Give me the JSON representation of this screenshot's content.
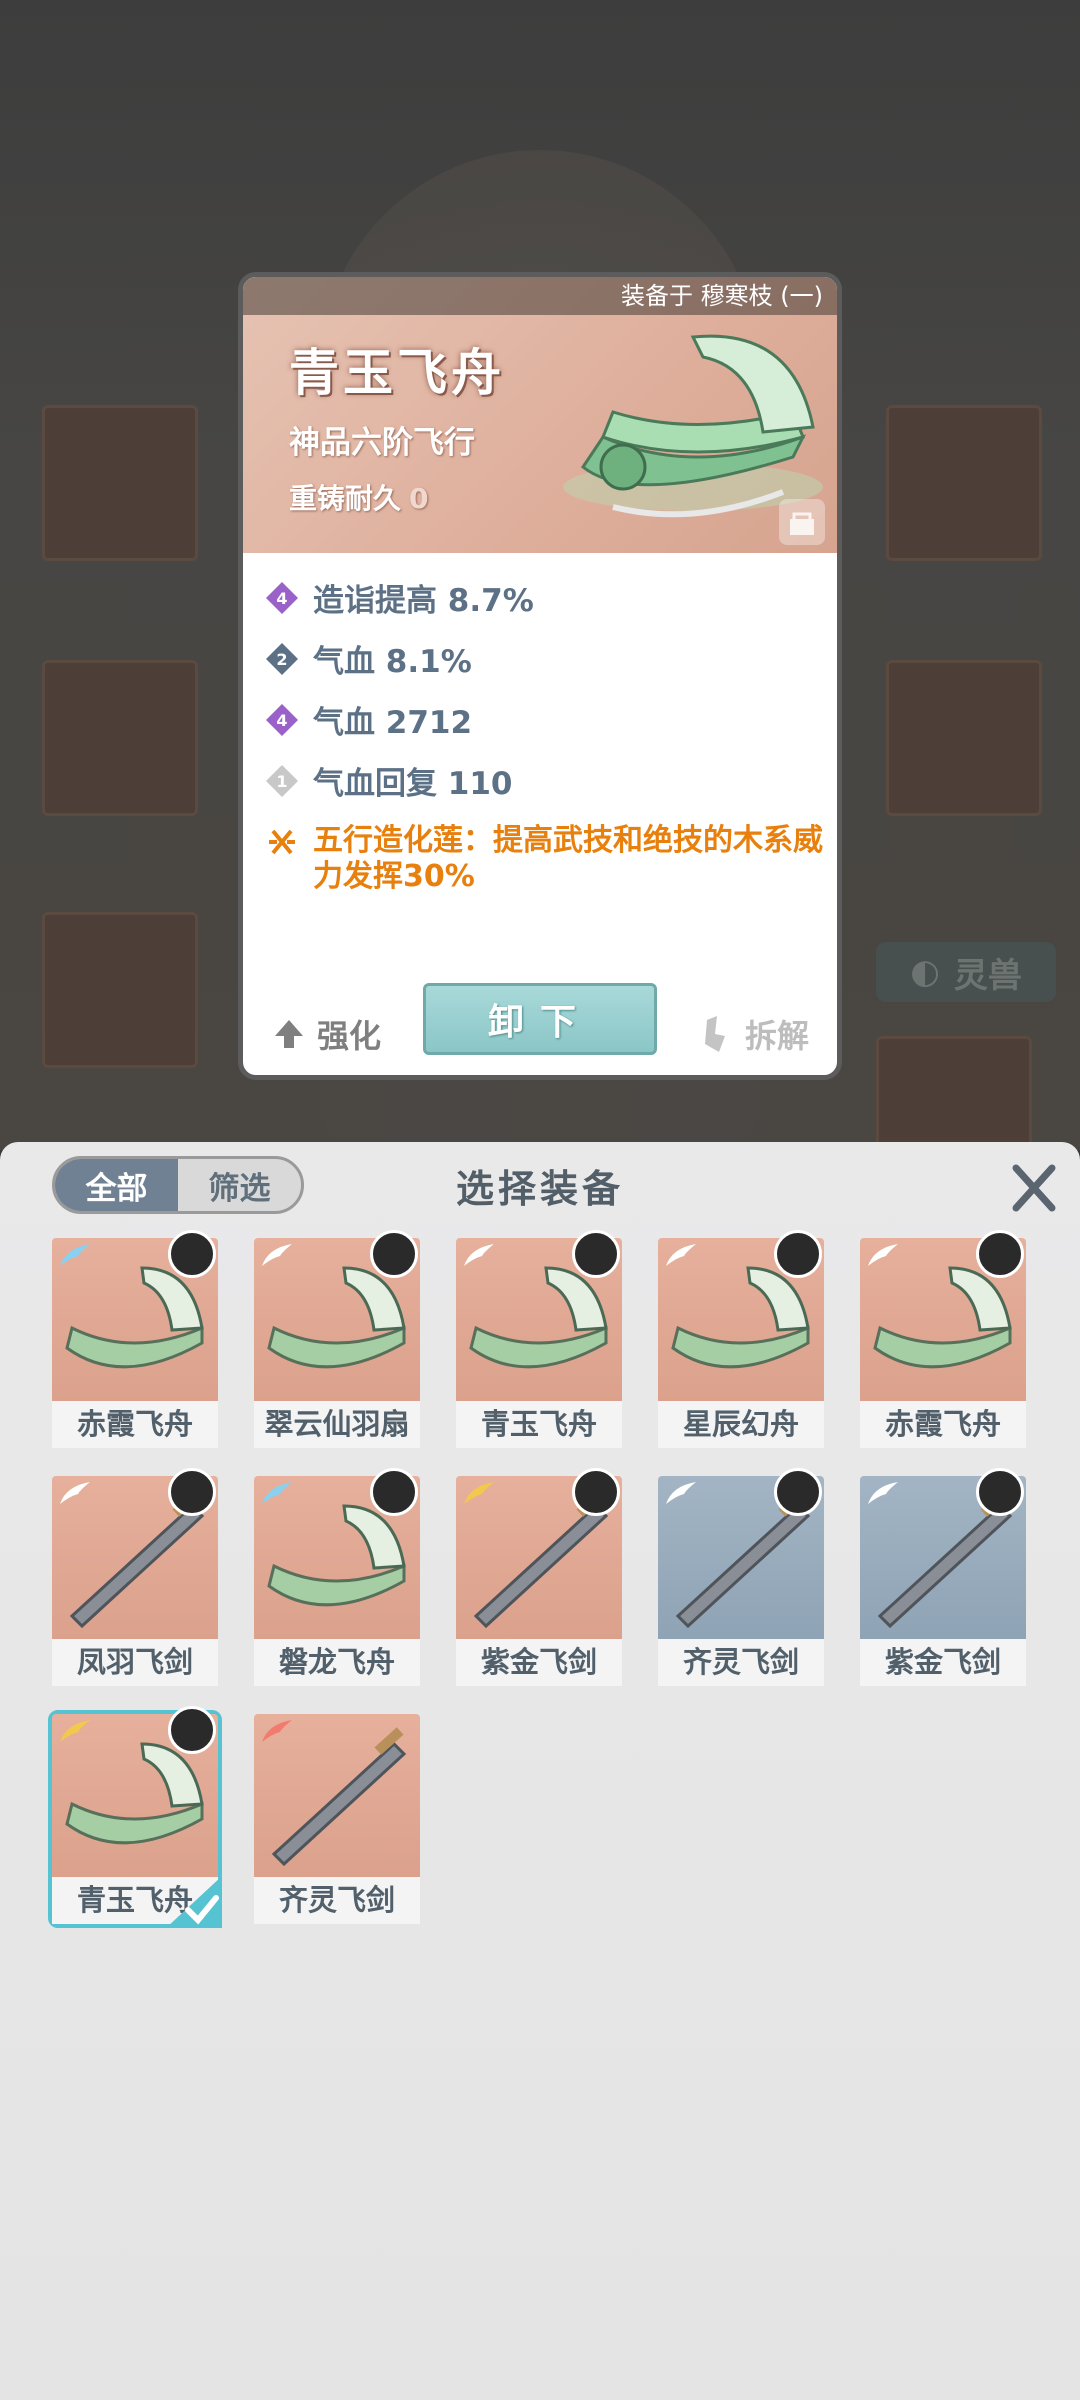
{
  "card": {
    "equipped_text": "装备于 穆寒枝 (一)",
    "name": "青玉飞舟",
    "grade": "神品六阶飞行",
    "durability_label": "重铸耐久",
    "durability_value": "0",
    "stats": [
      {
        "badge": "4",
        "text": "造诣提高 8.7%",
        "color": "#9a62c9"
      },
      {
        "badge": "2",
        "text": "气血 8.1%",
        "color": "#5c7186"
      },
      {
        "badge": "4",
        "text": "气血 2712",
        "color": "#9a62c9"
      },
      {
        "badge": "1",
        "text": "气血回复 110",
        "color": "#c8c8c8"
      }
    ],
    "special": "五行造化莲：提高武技和绝技的木系威力发挥30%",
    "strengthen_label": "强化",
    "unequip_label": "卸下",
    "dismantle_label": "拆解"
  },
  "background": {
    "spirit_beast_label": "灵兽"
  },
  "panel": {
    "tab_all": "全部",
    "tab_filter": "筛选",
    "title": "选择装备",
    "items": [
      {
        "name": "赤霞飞舟",
        "bg": "red",
        "wing": "#8ad0f0"
      },
      {
        "name": "翠云仙羽扇",
        "bg": "red",
        "wing": "#ffffff"
      },
      {
        "name": "青玉飞舟",
        "bg": "red",
        "wing": "#ffffff"
      },
      {
        "name": "星辰幻舟",
        "bg": "red",
        "wing": "#ffffff"
      },
      {
        "name": "赤霞飞舟",
        "bg": "red",
        "wing": "#ffffff"
      },
      {
        "name": "凤羽飞剑",
        "bg": "red",
        "wing": "#ffffff"
      },
      {
        "name": "磐龙飞舟",
        "bg": "red",
        "wing": "#8ad0f0"
      },
      {
        "name": "紫金飞剑",
        "bg": "red",
        "wing": "#f3c94d"
      },
      {
        "name": "齐灵飞剑",
        "bg": "blue",
        "wing": "#ffffff"
      },
      {
        "name": "紫金飞剑",
        "bg": "blue",
        "wing": "#ffffff"
      },
      {
        "name": "青玉飞舟",
        "bg": "red",
        "wing": "#f3c94d",
        "selected": true
      },
      {
        "name": "齐灵飞剑",
        "bg": "red",
        "wing": "#f27a6f"
      }
    ]
  }
}
